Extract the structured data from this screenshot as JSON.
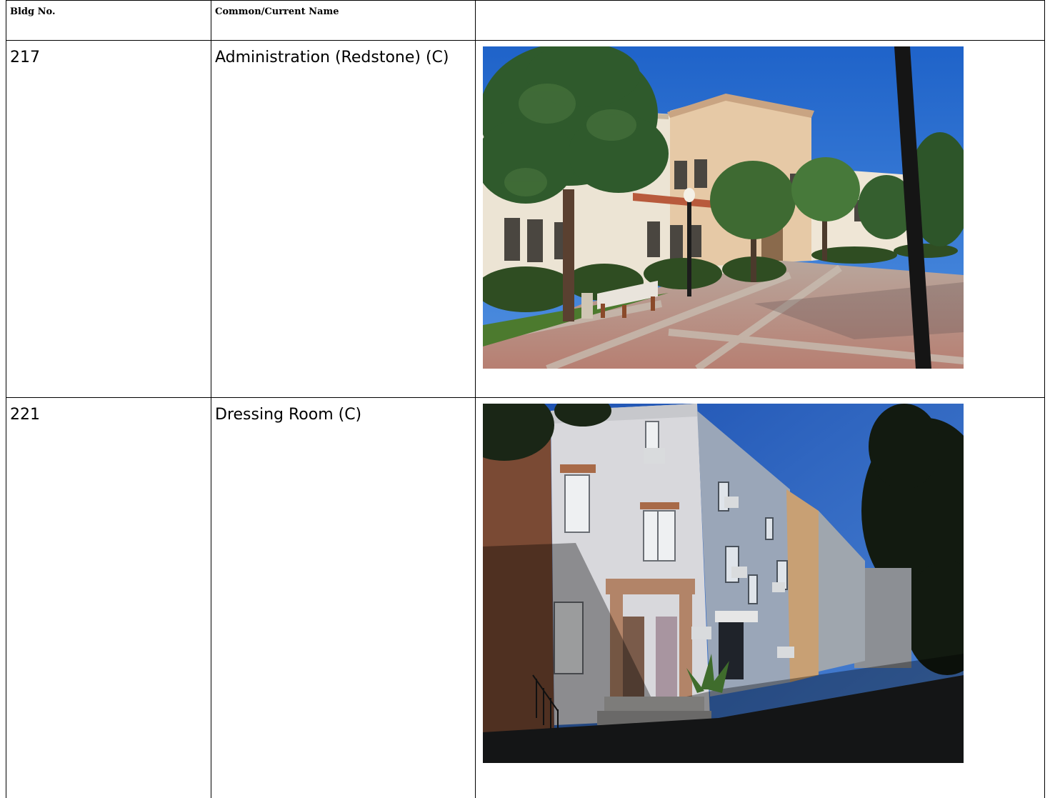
{
  "table": {
    "headers": {
      "bldg_no": "Bldg No.",
      "common_name": "Common/Current Name",
      "photo": ""
    },
    "rows": [
      {
        "bldg_no": "217",
        "name": "Administration (Redstone) (C)",
        "photo_subject": "administration-building-photo"
      },
      {
        "bldg_no": "221",
        "name": "Dressing Room (C)",
        "photo_subject": "dressing-room-building-photo"
      }
    ]
  }
}
